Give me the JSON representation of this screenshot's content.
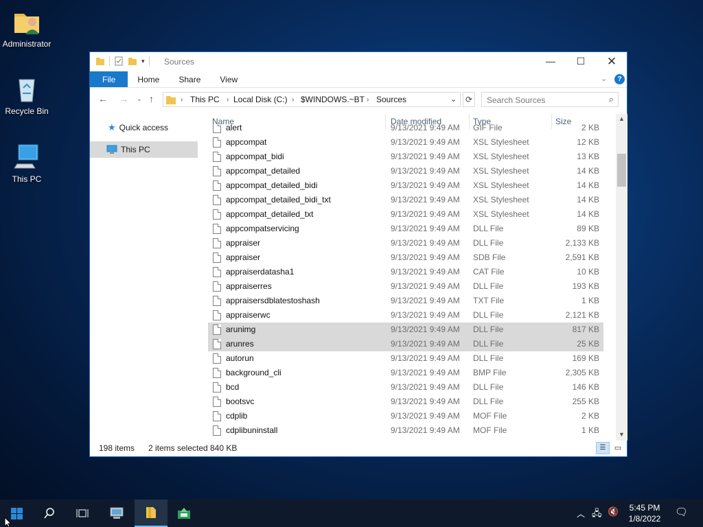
{
  "desktop": {
    "icons": [
      {
        "label": "Administrator",
        "icon": "user-folder-icon"
      },
      {
        "label": "Recycle Bin",
        "icon": "recycle-bin-icon"
      },
      {
        "label": "This PC",
        "icon": "computer-icon"
      }
    ]
  },
  "window": {
    "title": "Sources",
    "ribbon_tabs": [
      "File",
      "Home",
      "Share",
      "View"
    ],
    "breadcrumb": [
      "This PC",
      "Local Disk (C:)",
      "$WINDOWS.~BT",
      "Sources"
    ],
    "search_placeholder": "Search Sources",
    "nav": {
      "quick_access": "Quick access",
      "this_pc": "This PC"
    },
    "columns": {
      "name": "Name",
      "date": "Date modified",
      "type": "Type",
      "size": "Size"
    },
    "files": [
      {
        "name": "alert",
        "date": "9/13/2021 9:49 AM",
        "type": "GIF File",
        "size": "2 KB",
        "selected": false
      },
      {
        "name": "appcompat",
        "date": "9/13/2021 9:49 AM",
        "type": "XSL Stylesheet",
        "size": "12 KB",
        "selected": false
      },
      {
        "name": "appcompat_bidi",
        "date": "9/13/2021 9:49 AM",
        "type": "XSL Stylesheet",
        "size": "13 KB",
        "selected": false
      },
      {
        "name": "appcompat_detailed",
        "date": "9/13/2021 9:49 AM",
        "type": "XSL Stylesheet",
        "size": "14 KB",
        "selected": false
      },
      {
        "name": "appcompat_detailed_bidi",
        "date": "9/13/2021 9:49 AM",
        "type": "XSL Stylesheet",
        "size": "14 KB",
        "selected": false
      },
      {
        "name": "appcompat_detailed_bidi_txt",
        "date": "9/13/2021 9:49 AM",
        "type": "XSL Stylesheet",
        "size": "14 KB",
        "selected": false
      },
      {
        "name": "appcompat_detailed_txt",
        "date": "9/13/2021 9:49 AM",
        "type": "XSL Stylesheet",
        "size": "14 KB",
        "selected": false
      },
      {
        "name": "appcompatservicing",
        "date": "9/13/2021 9:49 AM",
        "type": "DLL File",
        "size": "89 KB",
        "selected": false
      },
      {
        "name": "appraiser",
        "date": "9/13/2021 9:49 AM",
        "type": "DLL File",
        "size": "2,133 KB",
        "selected": false
      },
      {
        "name": "appraiser",
        "date": "9/13/2021 9:49 AM",
        "type": "SDB File",
        "size": "2,591 KB",
        "selected": false
      },
      {
        "name": "appraiserdatasha1",
        "date": "9/13/2021 9:49 AM",
        "type": "CAT File",
        "size": "10 KB",
        "selected": false
      },
      {
        "name": "appraiserres",
        "date": "9/13/2021 9:49 AM",
        "type": "DLL File",
        "size": "193 KB",
        "selected": false
      },
      {
        "name": "appraisersdblatestoshash",
        "date": "9/13/2021 9:49 AM",
        "type": "TXT File",
        "size": "1 KB",
        "selected": false
      },
      {
        "name": "appraiserwc",
        "date": "9/13/2021 9:49 AM",
        "type": "DLL File",
        "size": "2,121 KB",
        "selected": false
      },
      {
        "name": "arunimg",
        "date": "9/13/2021 9:49 AM",
        "type": "DLL File",
        "size": "817 KB",
        "selected": true
      },
      {
        "name": "arunres",
        "date": "9/13/2021 9:49 AM",
        "type": "DLL File",
        "size": "25 KB",
        "selected": true
      },
      {
        "name": "autorun",
        "date": "9/13/2021 9:49 AM",
        "type": "DLL File",
        "size": "169 KB",
        "selected": false
      },
      {
        "name": "background_cli",
        "date": "9/13/2021 9:49 AM",
        "type": "BMP File",
        "size": "2,305 KB",
        "selected": false
      },
      {
        "name": "bcd",
        "date": "9/13/2021 9:49 AM",
        "type": "DLL File",
        "size": "146 KB",
        "selected": false
      },
      {
        "name": "bootsvc",
        "date": "9/13/2021 9:49 AM",
        "type": "DLL File",
        "size": "255 KB",
        "selected": false
      },
      {
        "name": "cdplib",
        "date": "9/13/2021 9:49 AM",
        "type": "MOF File",
        "size": "2 KB",
        "selected": false
      },
      {
        "name": "cdplibuninstall",
        "date": "9/13/2021 9:49 AM",
        "type": "MOF File",
        "size": "1 KB",
        "selected": false
      }
    ],
    "status": {
      "items": "198 items",
      "selected": "2 items selected",
      "size": "840 KB"
    }
  },
  "taskbar": {
    "time": "5:45 PM",
    "date": "1/8/2022"
  },
  "colors": {
    "accent": "#1979ca",
    "selection": "#d9d9d9",
    "taskbar": "#0e1a2c"
  }
}
